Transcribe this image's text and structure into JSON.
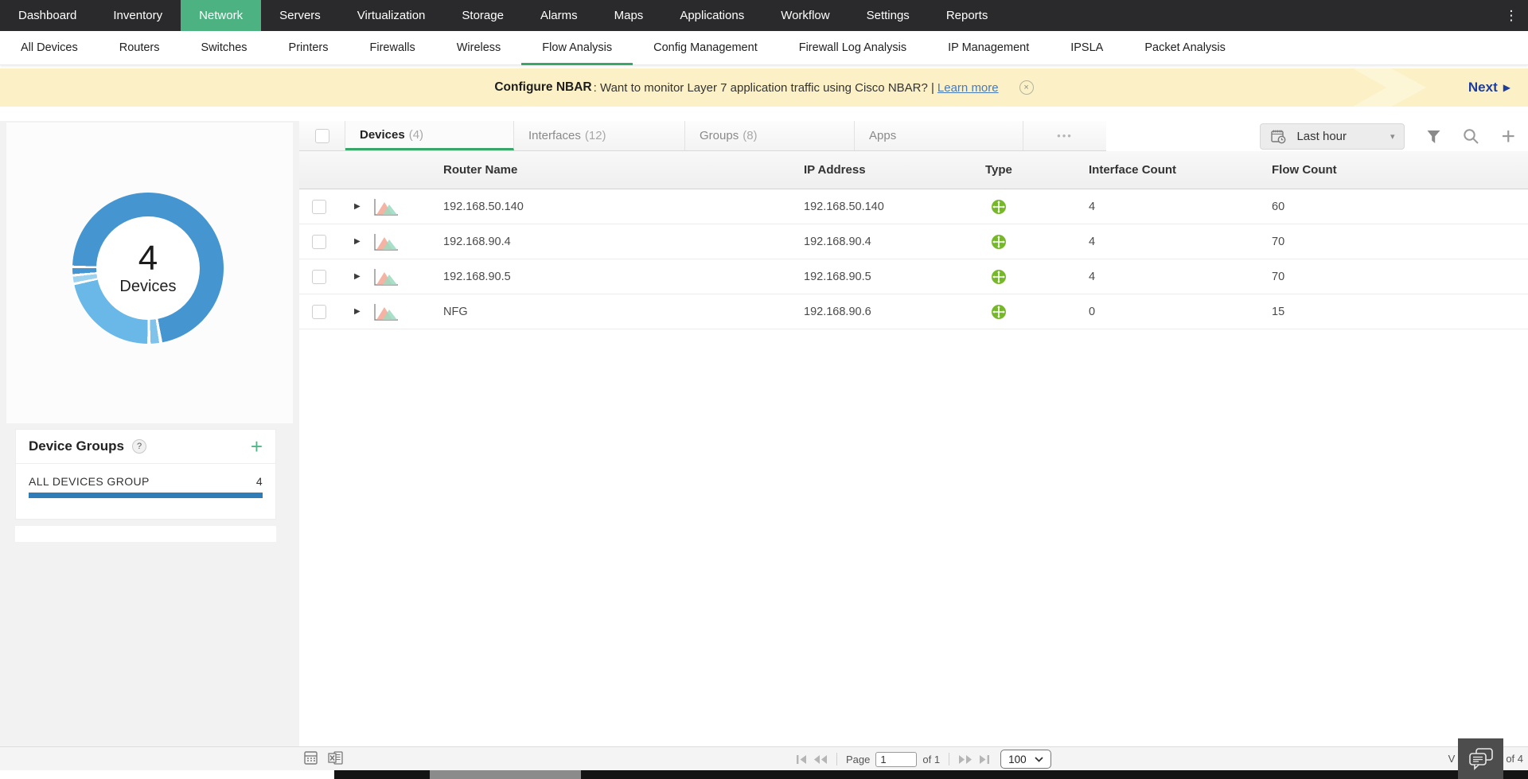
{
  "theme": {
    "nav_bg": "#2a2a2c",
    "nav_active_green": "#4cb282",
    "accent_green": "#3aa66a",
    "banner_bg": "#fcf1c6",
    "link_blue": "#4a7ab5",
    "next_blue": "#1f3e99",
    "donut_primary": "#4595d0",
    "donut_secondary": "#69b8e8",
    "type_icon_green": "#76b82a",
    "group_bar_blue": "#2e7cb8"
  },
  "icons": {
    "kebab": "⋮",
    "caret_right": "▶",
    "dropdown_caret": "▾",
    "plus": "+",
    "close": "×",
    "help": "?",
    "more": "•••",
    "next_arrow": "▶"
  },
  "topnav": {
    "items": [
      {
        "label": "Dashboard"
      },
      {
        "label": "Inventory"
      },
      {
        "label": "Network"
      },
      {
        "label": "Servers"
      },
      {
        "label": "Virtualization"
      },
      {
        "label": "Storage"
      },
      {
        "label": "Alarms"
      },
      {
        "label": "Maps"
      },
      {
        "label": "Applications"
      },
      {
        "label": "Workflow"
      },
      {
        "label": "Settings"
      },
      {
        "label": "Reports"
      }
    ],
    "active_item": "Network"
  },
  "subnav": {
    "items": [
      {
        "label": "All Devices"
      },
      {
        "label": "Routers"
      },
      {
        "label": "Switches"
      },
      {
        "label": "Printers"
      },
      {
        "label": "Firewalls"
      },
      {
        "label": "Wireless"
      },
      {
        "label": "Flow Analysis"
      },
      {
        "label": "Config Management"
      },
      {
        "label": "Firewall Log Analysis"
      },
      {
        "label": "IP Management"
      },
      {
        "label": "IPSLA"
      },
      {
        "label": "Packet Analysis"
      }
    ],
    "active_item": "Flow Analysis"
  },
  "banner": {
    "title": "Configure NBAR",
    "message": ": Want to monitor Layer 7 application traffic using Cisco NBAR? |",
    "link_label": "Learn more",
    "next_label": "Next"
  },
  "sidebar": {
    "donut": {
      "center_value": "4",
      "center_label": "Devices",
      "segment_count": 4
    },
    "device_groups": {
      "title": "Device Groups",
      "help_badge": "?",
      "groups": [
        {
          "name": "ALL DEVICES GROUP",
          "count": "4"
        }
      ]
    }
  },
  "toolbar": {
    "tabs": [
      {
        "label": "Devices",
        "count": "(4)"
      },
      {
        "label": "Interfaces",
        "count": "(12)"
      },
      {
        "label": "Groups",
        "count": "(8)"
      },
      {
        "label": "Apps",
        "count": ""
      }
    ],
    "active_tab": "Devices",
    "time_range": "Last hour"
  },
  "table": {
    "columns": [
      "Router Name",
      "IP Address",
      "Type",
      "Interface Count",
      "Flow Count"
    ],
    "rows": [
      {
        "name": "192.168.50.140",
        "ip": "192.168.50.140",
        "interface_count": "4",
        "flow_count": "60"
      },
      {
        "name": "192.168.90.4",
        "ip": "192.168.90.4",
        "interface_count": "4",
        "flow_count": "70"
      },
      {
        "name": "192.168.90.5",
        "ip": "192.168.90.5",
        "interface_count": "4",
        "flow_count": "70"
      },
      {
        "name": "NFG",
        "ip": "192.168.90.6",
        "interface_count": "0",
        "flow_count": "15"
      }
    ]
  },
  "footer": {
    "page_label": "Page",
    "page_value": "1",
    "page_total": "of 1",
    "page_size": "100",
    "records_prefix": "V",
    "records_suffix": "of 4"
  }
}
